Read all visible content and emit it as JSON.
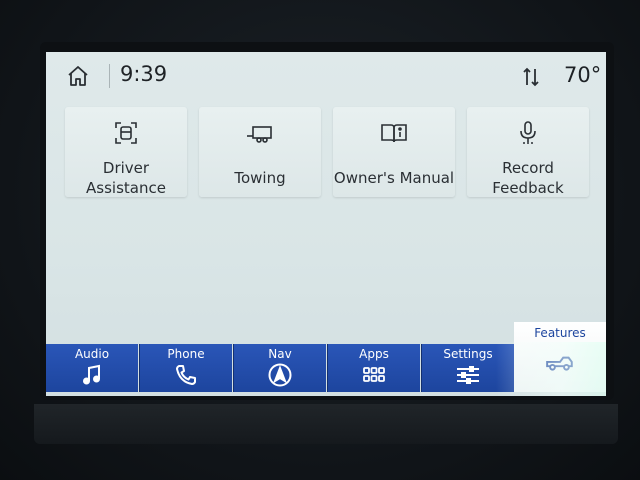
{
  "status_bar": {
    "time": "9:39",
    "temperature": "70°",
    "home_icon": "home-icon",
    "sort_icon": "sort-arrows-icon"
  },
  "tiles": [
    {
      "label": "Driver\nAssistance",
      "icon": "driver-assist-icon"
    },
    {
      "label": "Towing",
      "icon": "trailer-icon"
    },
    {
      "label": "Owner's Manual",
      "icon": "book-icon"
    },
    {
      "label": "Record\nFeedback",
      "icon": "microphone-icon"
    }
  ],
  "nav": [
    {
      "label": "Audio",
      "icon": "music-note-icon"
    },
    {
      "label": "Phone",
      "icon": "phone-icon"
    },
    {
      "label": "Nav",
      "icon": "navigation-arrow-icon"
    },
    {
      "label": "Apps",
      "icon": "apps-grid-icon"
    },
    {
      "label": "Settings",
      "icon": "sliders-icon"
    },
    {
      "label": "Features",
      "icon": "truck-icon",
      "active": true
    }
  ],
  "colors": {
    "nav_blue": "#2a56b8",
    "screen_bg": "#dfe9ea",
    "text": "#2a2f34"
  }
}
